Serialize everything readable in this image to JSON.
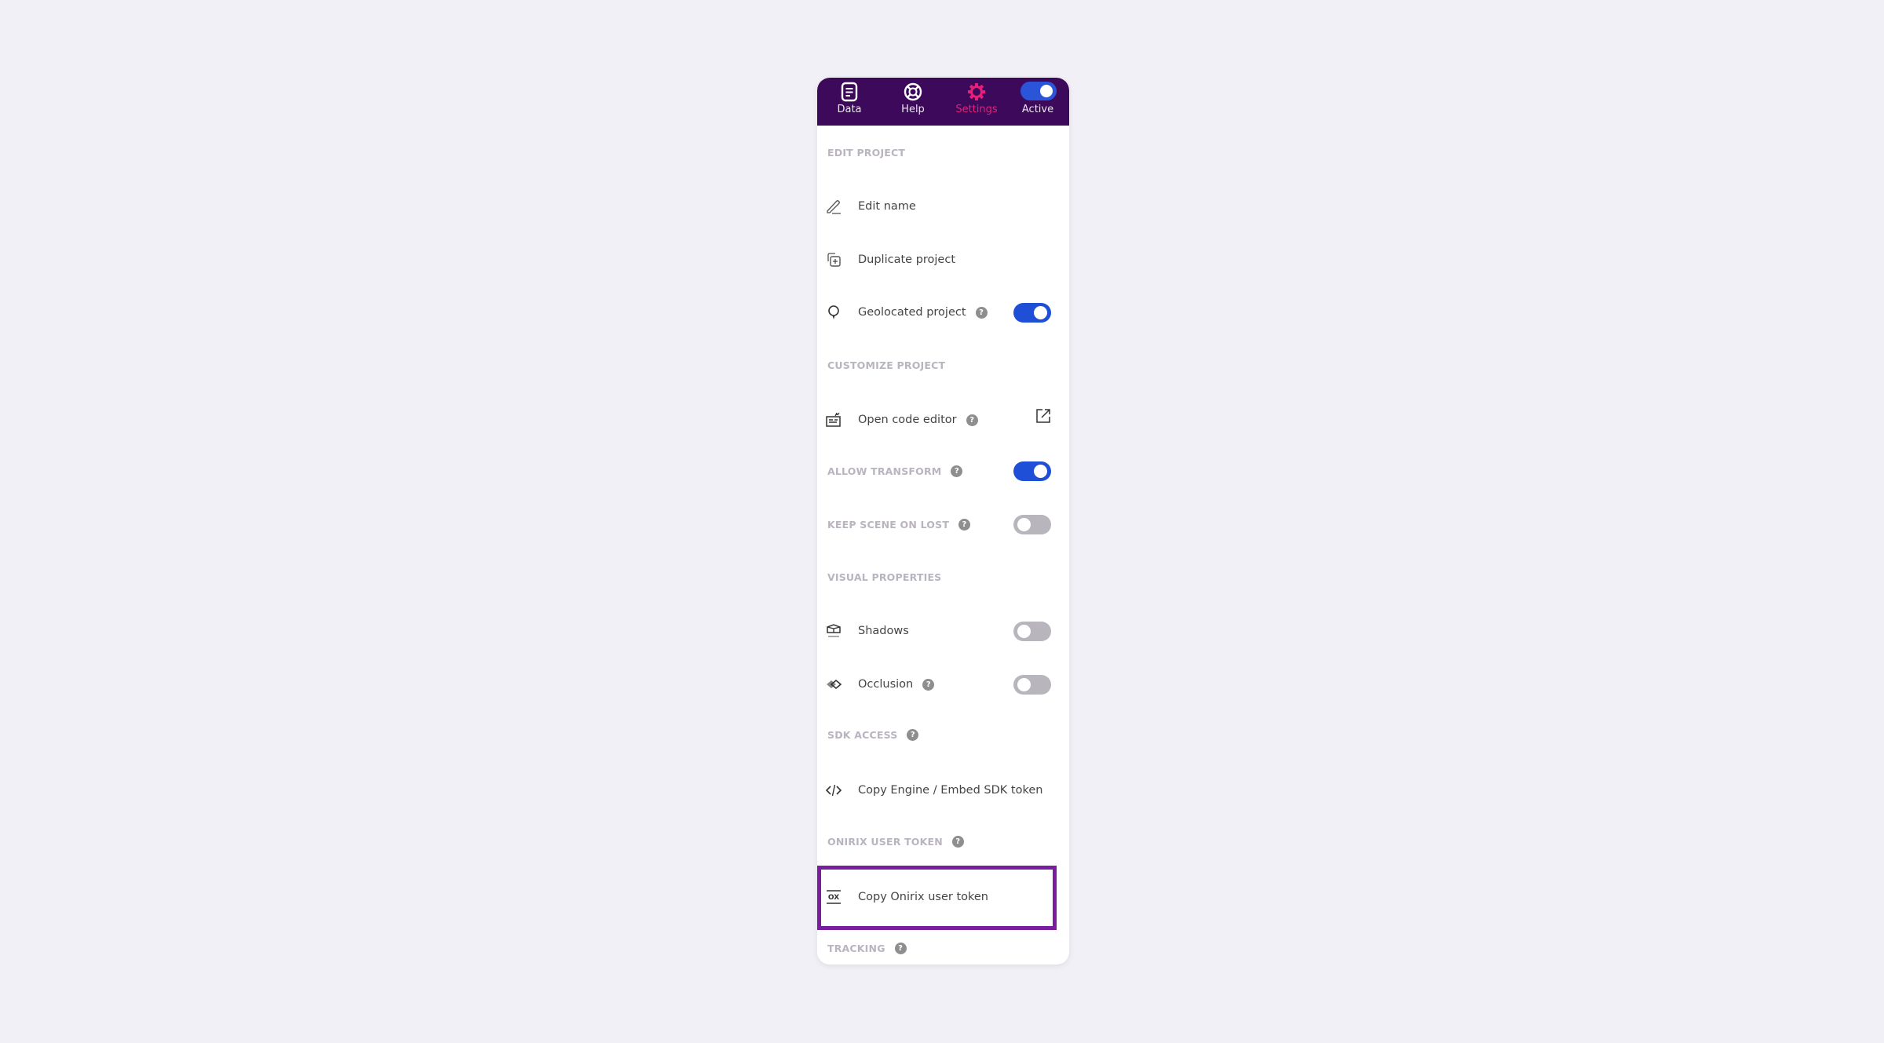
{
  "header": {
    "tabs": [
      {
        "label": "Data",
        "icon": "document-list-icon"
      },
      {
        "label": "Help",
        "icon": "lifebuoy-icon"
      },
      {
        "label": "Settings",
        "icon": "gear-icon",
        "active": true
      },
      {
        "label": "Active",
        "icon": "toggle-icon",
        "toggle_on": true
      }
    ]
  },
  "sections": {
    "edit_project": "EDIT PROJECT",
    "customize_project": "CUSTOMIZE PROJECT",
    "allow_transform": "ALLOW TRANSFORM",
    "keep_scene_on_lost": "KEEP SCENE ON LOST",
    "visual_properties": "VISUAL PROPERTIES",
    "sdk_access": "SDK ACCESS",
    "onirix_user_token": "ONIRIX USER TOKEN",
    "tracking": "TRACKING"
  },
  "items": {
    "edit_name": "Edit name",
    "duplicate_project": "Duplicate project",
    "geolocated_project": "Geolocated project",
    "open_code_editor": "Open code editor",
    "shadows": "Shadows",
    "occlusion": "Occlusion",
    "copy_sdk_token": "Copy Engine / Embed SDK token",
    "copy_user_token": "Copy Onirix user token"
  },
  "toggles": {
    "geolocated_project": true,
    "allow_transform": true,
    "keep_scene_on_lost": false,
    "shadows": false,
    "occlusion": false
  },
  "help_glyph": "?",
  "colors": {
    "header_bg": "#3d0a5b",
    "active_tab": "#e81e78",
    "toggle_on": "#1f4fd6",
    "toggle_off": "#b8b5bc",
    "highlight": "#7a1ea0"
  }
}
